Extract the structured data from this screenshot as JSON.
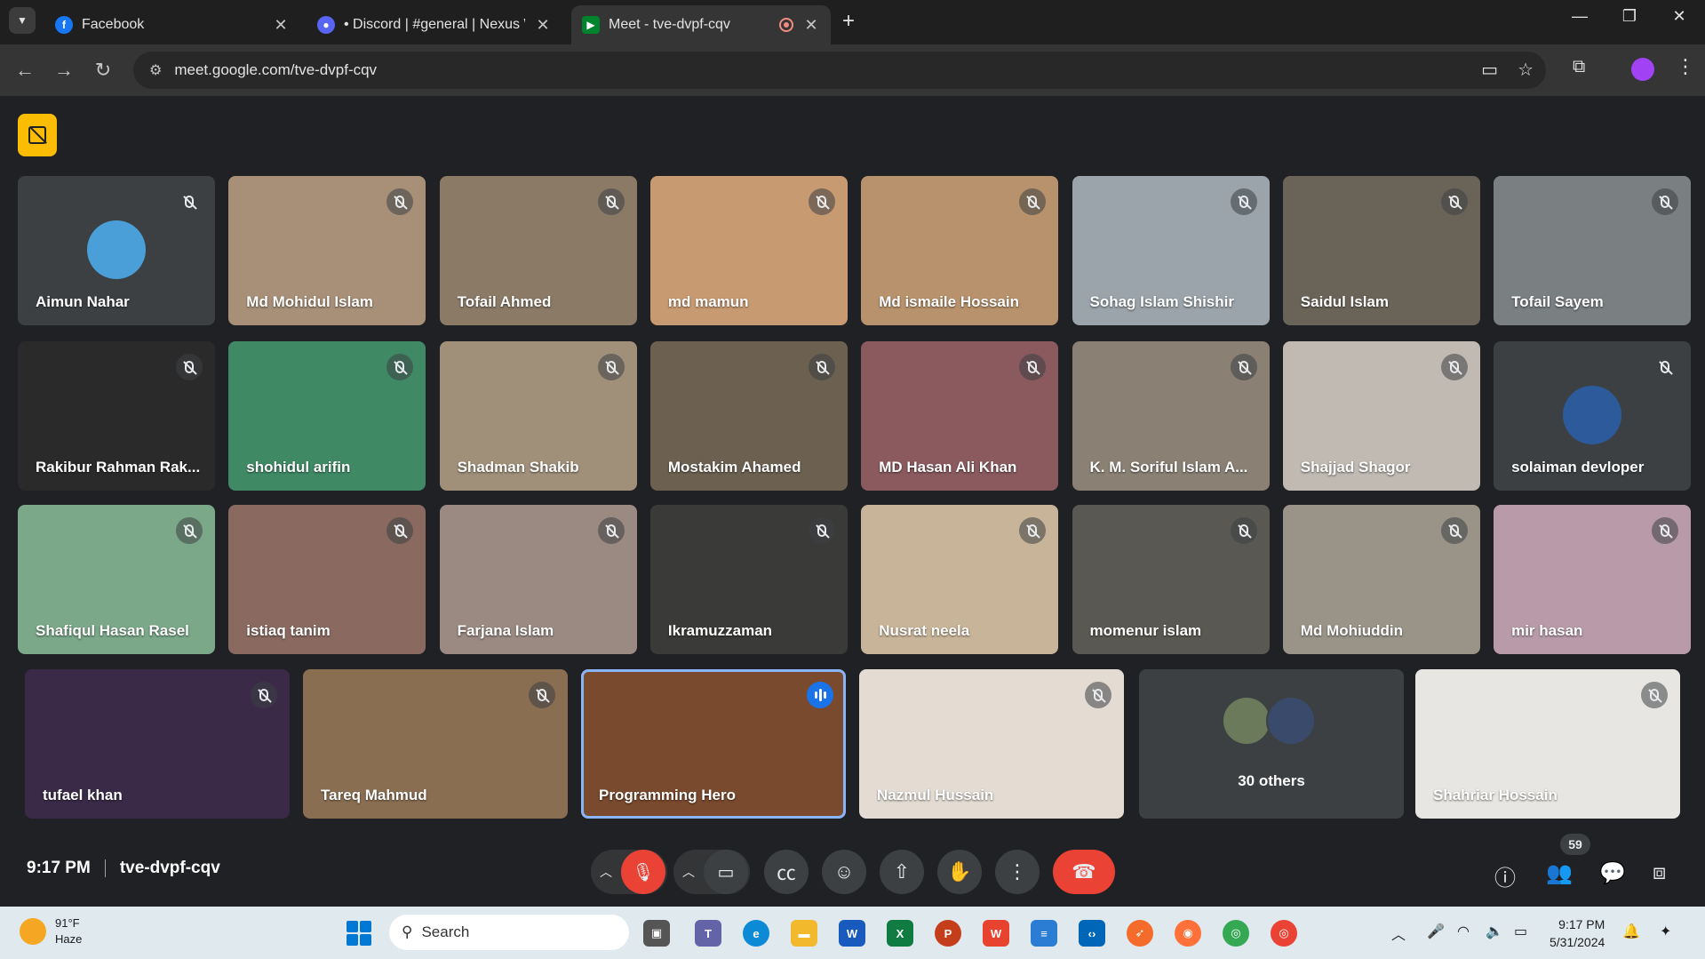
{
  "browser": {
    "tabs": [
      {
        "title": "Facebook",
        "active": false
      },
      {
        "title": "• Discord | #general | Nexus Wa",
        "active": false
      },
      {
        "title": "Meet - tve-dvpf-cqv",
        "active": true
      }
    ],
    "url": "meet.google.com/tve-dvpf-cqv"
  },
  "participants": [
    {
      "name": "Aimun Nahar",
      "bg": "#3c4043",
      "avatar": "#4a9fd8"
    },
    {
      "name": "Md Mohidul Islam",
      "bg": "#a89078"
    },
    {
      "name": "Tofail Ahmed",
      "bg": "#8a7a66"
    },
    {
      "name": "md mamun",
      "bg": "#c89a72"
    },
    {
      "name": "Md ismaile Hossain",
      "bg": "#b8926c"
    },
    {
      "name": "Sohag Islam Shishir",
      "bg": "#9aa4aa"
    },
    {
      "name": "Saidul Islam",
      "bg": "#6a6458"
    },
    {
      "name": "Tofail Sayem",
      "bg": "#7a7f82"
    },
    {
      "name": "Rakibur Rahman Rak...",
      "bg": "#2a2a2a"
    },
    {
      "name": "shohidul arifin",
      "bg": "#3f8a64"
    },
    {
      "name": "Shadman Shakib",
      "bg": "#a0907a"
    },
    {
      "name": "Mostakim Ahamed",
      "bg": "#6c6050"
    },
    {
      "name": "MD Hasan Ali Khan",
      "bg": "#8a5a5e"
    },
    {
      "name": "K. M. Soriful Islam A...",
      "bg": "#8a8074"
    },
    {
      "name": "Shajjad Shagor",
      "bg": "#c0bab2"
    },
    {
      "name": "solaiman devloper",
      "bg": "#3c4043",
      "avatar": "#2d5a9a"
    },
    {
      "name": "Shafiqul Hasan Rasel",
      "bg": "#7aa888"
    },
    {
      "name": "istiaq tanim",
      "bg": "#8a6a60"
    },
    {
      "name": "Farjana Islam",
      "bg": "#9a8a82"
    },
    {
      "name": "Ikramuzzaman",
      "bg": "#3a3a38"
    },
    {
      "name": "Nusrat neela",
      "bg": "#c8b498"
    },
    {
      "name": "momenur islam",
      "bg": "#5a5852"
    },
    {
      "name": "Md Mohiuddin",
      "bg": "#9a9488"
    },
    {
      "name": "mir hasan",
      "bg": "#b89aa8"
    },
    {
      "name": "tufael khan",
      "bg": "#3a2a48"
    },
    {
      "name": "Tareq Mahmud",
      "bg": "#8a6e52"
    },
    {
      "name": "Programming Hero",
      "bg": "#7a4a2e"
    },
    {
      "name": "Nazmul Hussain",
      "bg": "#e4dcd2"
    },
    {
      "name": "Shahriar Hossain",
      "bg": "#e8e6e2"
    }
  ],
  "others": {
    "label": "30 others",
    "avatars": [
      "#6a7a5a",
      "#3a4a6a"
    ]
  },
  "meeting": {
    "time": "9:17 PM",
    "code": "tve-dvpf-cqv",
    "people_count": "59"
  },
  "taskbar": {
    "weather_temp": "91°F",
    "weather_desc": "Haze",
    "search_placeholder": "Search",
    "time": "9:17 PM",
    "date": "5/31/2024"
  },
  "colors": {
    "speaking": "#8ab4f8",
    "end_call": "#ea4335",
    "caption_btn": "#fbbc04"
  }
}
